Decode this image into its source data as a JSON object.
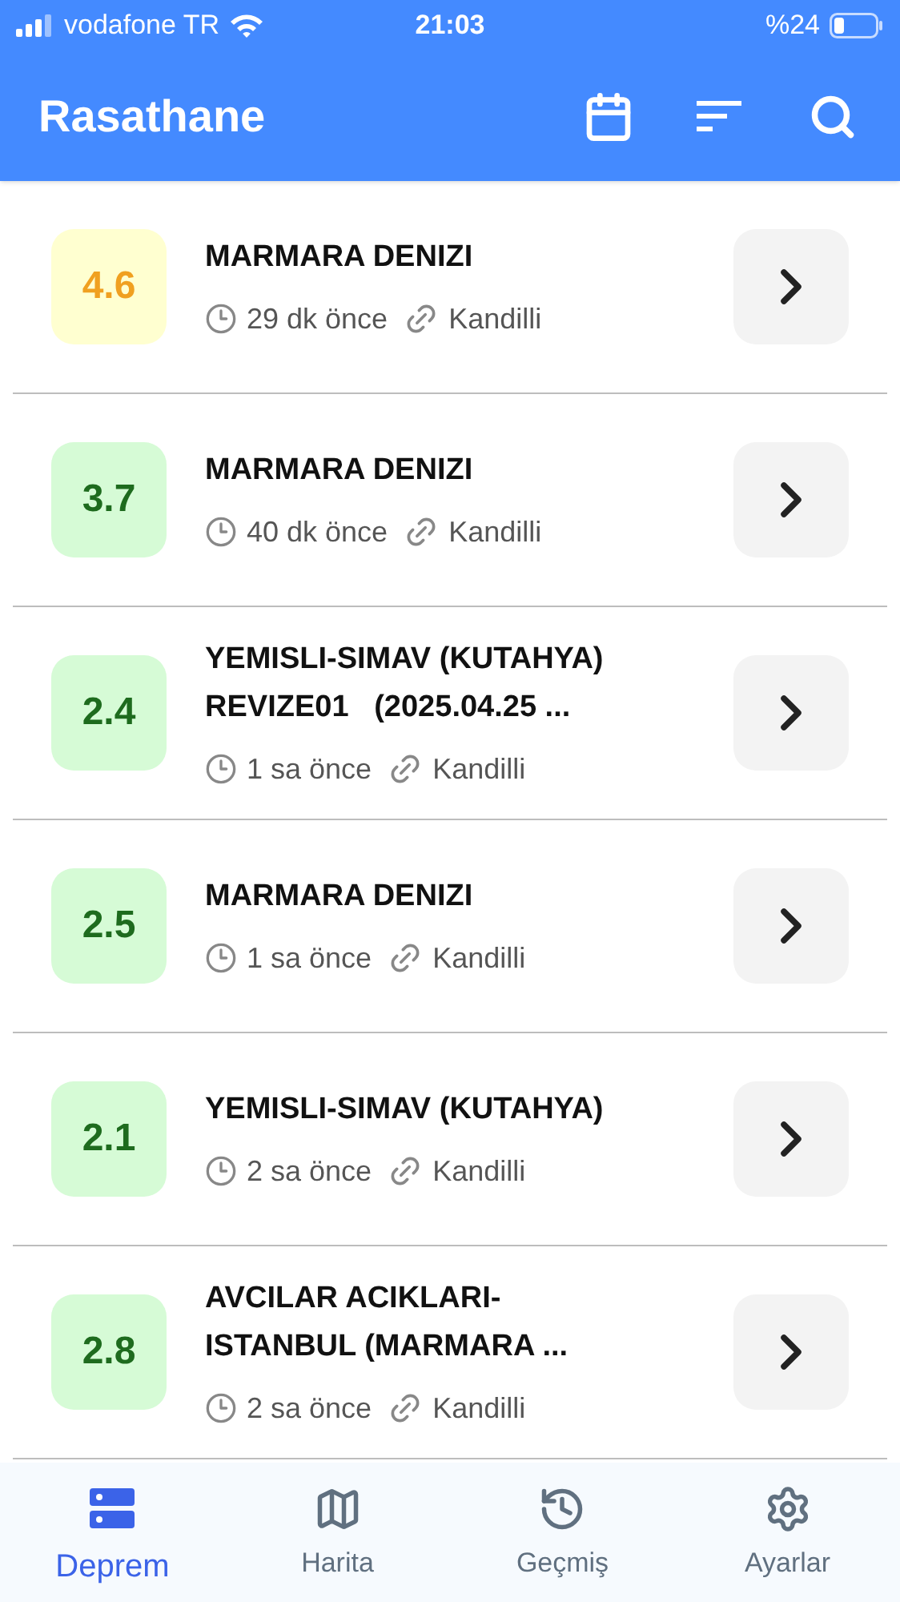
{
  "status_bar": {
    "carrier": "vodafone TR",
    "time": "21:03",
    "battery": "%24"
  },
  "app_bar": {
    "title": "Rasathane"
  },
  "quakes": [
    {
      "magnitude": "4.6",
      "kind": "moderate",
      "title_lines": [
        "MARMARA DENIZI"
      ],
      "time": "29 dk önce",
      "source": "Kandilli"
    },
    {
      "magnitude": "3.7",
      "kind": "minor",
      "title_lines": [
        "MARMARA DENIZI"
      ],
      "time": "40 dk önce",
      "source": "Kandilli"
    },
    {
      "magnitude": "2.4",
      "kind": "minor",
      "title_lines": [
        "YEMISLI-SIMAV (KUTAHYA)",
        "REVIZE01   (2025.04.25 ..."
      ],
      "time": "1 sa önce",
      "source": "Kandilli"
    },
    {
      "magnitude": "2.5",
      "kind": "minor",
      "title_lines": [
        "MARMARA DENIZI"
      ],
      "time": "1 sa önce",
      "source": "Kandilli"
    },
    {
      "magnitude": "2.1",
      "kind": "minor",
      "title_lines": [
        "YEMISLI-SIMAV (KUTAHYA)"
      ],
      "time": "2 sa önce",
      "source": "Kandilli"
    },
    {
      "magnitude": "2.8",
      "kind": "minor",
      "title_lines": [
        "AVCILAR ACIKLARI-",
        "ISTANBUL (MARMARA ..."
      ],
      "time": "2 sa önce",
      "source": "Kandilli"
    }
  ],
  "nav": [
    {
      "label": "Deprem",
      "selected": true
    },
    {
      "label": "Harita",
      "selected": false
    },
    {
      "label": "Geçmiş",
      "selected": false
    },
    {
      "label": "Ayarlar",
      "selected": false
    }
  ]
}
